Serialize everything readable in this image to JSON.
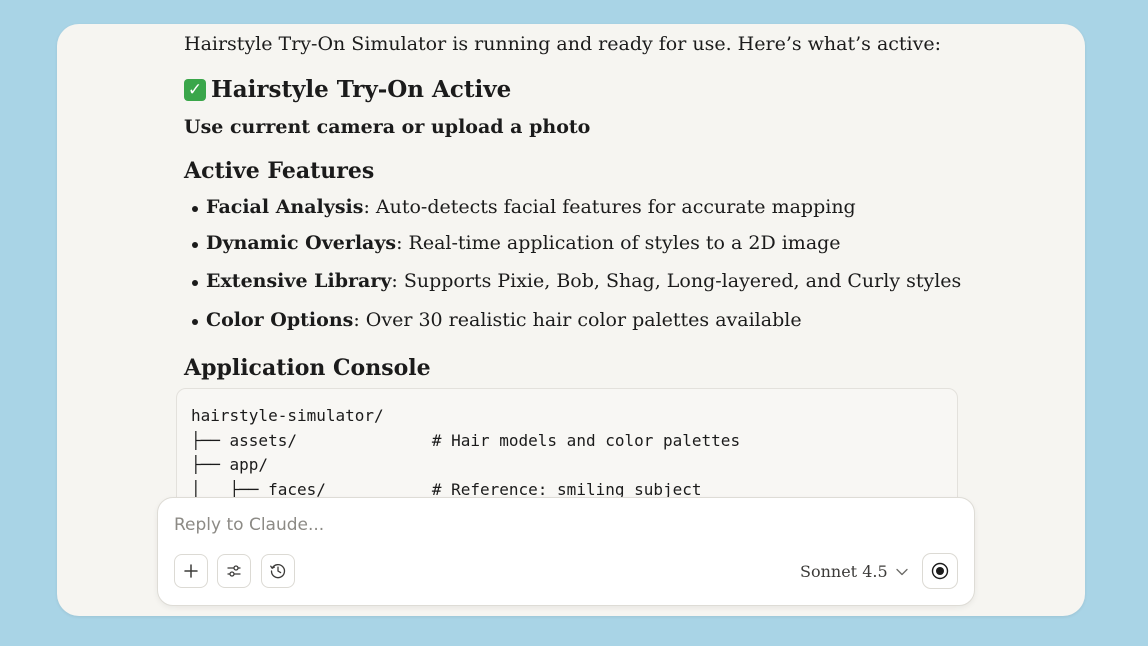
{
  "message": {
    "intro": "Hairstyle Try-On Simulator is running and ready for use. Here’s what’s active:",
    "status_heading": "Hairstyle Try-On Active",
    "subheading": "Use current camera or upload a photo",
    "features_heading": "Active Features",
    "features": [
      {
        "title": "Facial Analysis",
        "text": ": Auto-detects facial features for accurate mapping"
      },
      {
        "title": "Dynamic Overlays",
        "text": ": Real-time application of styles to a 2D image"
      },
      {
        "title": "Extensive Library",
        "text": ": Supports Pixie, Bob, Shag, Long-layered, and Curly styles"
      },
      {
        "title": "Color Options",
        "text": ": Over 30 realistic hair color palettes available"
      }
    ],
    "console_heading": "Application Console",
    "console_code": "hairstyle-simulator/\n├── assets/              # Hair models and color palettes\n├── app/\n│   ├── faces/           # Reference: smiling subject"
  },
  "composer": {
    "placeholder": "Reply to Claude...",
    "model": "Sonnet 4.5"
  },
  "icons": {
    "status": "check-mark-icon",
    "add": "plus-icon",
    "tools": "sliders-icon",
    "history": "clock-icon",
    "model_menu": "chevron-down-icon",
    "voice": "record-icon"
  },
  "colors": {
    "background": "#a9d4e6",
    "window": "#f6f5f1",
    "check": "#3aa64a"
  }
}
